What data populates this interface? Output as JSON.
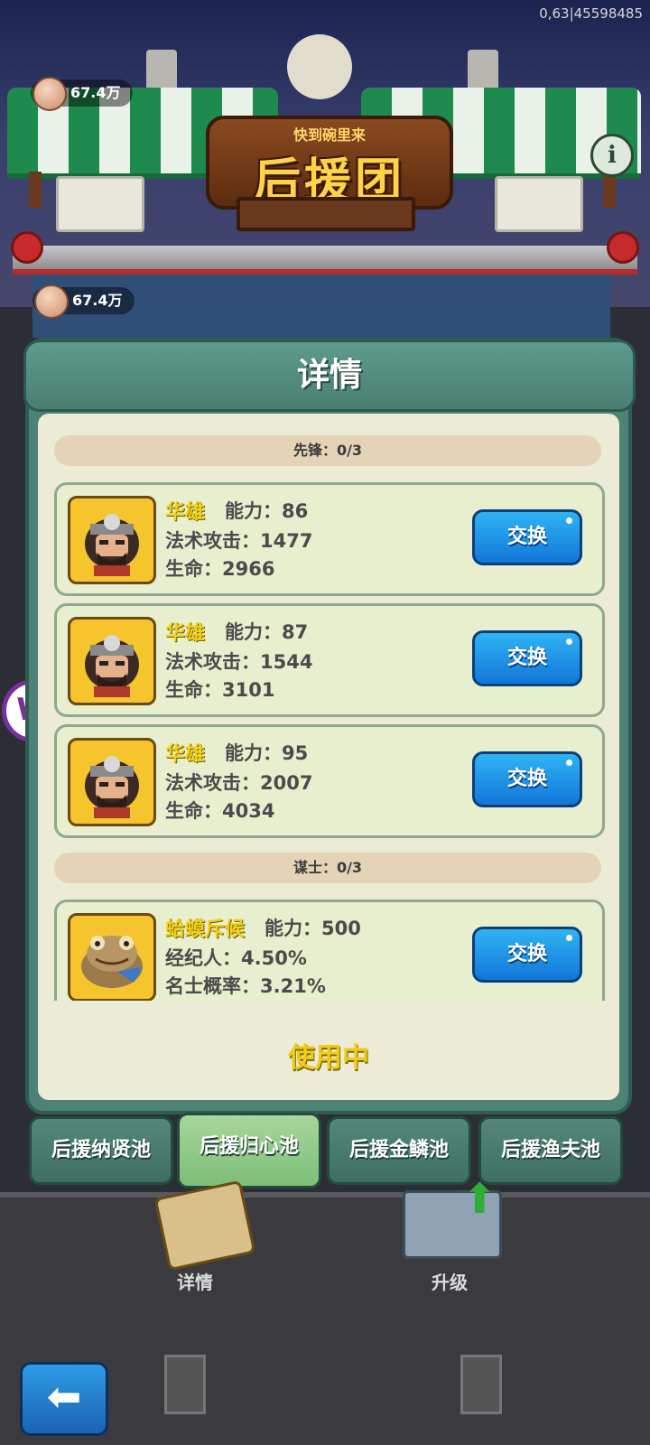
{
  "hud": {
    "debug_text": "0,63|45598485"
  },
  "top_coin": {
    "amount": "67.4万"
  },
  "mid_coin": {
    "amount": "67.4万"
  },
  "banner": {
    "subtitle": "快到碗里来",
    "title": "后援团"
  },
  "info_button": {
    "label": "i"
  },
  "dialog": {
    "title": "详情",
    "sections": [
      {
        "label": "先锋：0/3"
      },
      {
        "label": "谋士：0/3"
      }
    ],
    "cards": [
      {
        "name": "华雄",
        "power": "能力：86",
        "line1": "法术攻击：1477",
        "line2": "生命：2966",
        "button": "交换"
      },
      {
        "name": "华雄",
        "power": "能力：87",
        "line1": "法术攻击：1544",
        "line2": "生命：3101",
        "button": "交换"
      },
      {
        "name": "华雄",
        "power": "能力：95",
        "line1": "法术攻击：2007",
        "line2": "生命：4034",
        "button": "交换"
      },
      {
        "name": "蛤蟆斥候",
        "power": "能力：500",
        "line1": "经纪人：4.50%",
        "line2": "名士概率：3.21%",
        "button": "交换"
      }
    ],
    "status": "使用中"
  },
  "tabs": [
    {
      "label": "后援纳贤池",
      "active": false
    },
    {
      "label": "后援归心池",
      "active": true
    },
    {
      "label": "后援金鳞池",
      "active": false
    },
    {
      "label": "后援渔夫池",
      "active": false
    }
  ],
  "bottom": {
    "details_label": "详情",
    "upgrade_label": "升级"
  },
  "colors": {
    "swap_button": "#1f8fe6",
    "active_tab": "#8fca85",
    "dialog": "#4d8275",
    "name_yellow": "#f1d01c"
  },
  "icons": {
    "coin": "coin-icon",
    "back": "back-arrow-icon",
    "upgrade": "upgrade-arrow-icon",
    "info": "info-icon"
  }
}
